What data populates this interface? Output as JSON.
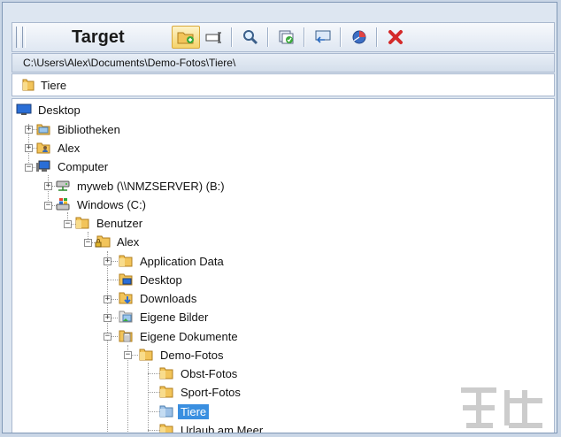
{
  "toolbar": {
    "title": "Target",
    "buttons": [
      {
        "name": "new-folder-icon"
      },
      {
        "name": "rename-icon"
      },
      {
        "name": "search-icon"
      },
      {
        "name": "copy-check-icon"
      },
      {
        "name": "monitor-arrow-icon"
      },
      {
        "name": "refresh-icon"
      },
      {
        "name": "delete-icon"
      }
    ]
  },
  "path": "C:\\Users\\Alex\\Documents\\Demo-Fotos\\Tiere\\",
  "current_folder": "Tiere",
  "tree": {
    "desktop": "Desktop",
    "bibliotheken": "Bibliotheken",
    "alex_root": "Alex",
    "computer": "Computer",
    "myweb": "myweb (\\\\NMZSERVER) (B:)",
    "windows": "Windows (C:)",
    "benutzer": "Benutzer",
    "alex": "Alex",
    "application_data": "Application Data",
    "desktop2": "Desktop",
    "downloads": "Downloads",
    "eigene_bilder": "Eigene Bilder",
    "eigene_dokumente": "Eigene Dokumente",
    "demo_fotos": "Demo-Fotos",
    "obst_fotos": "Obst-Fotos",
    "sport_fotos": "Sport-Fotos",
    "tiere": "Tiere",
    "urlaub": "Urlaub am Meer"
  },
  "colors": {
    "selection": "#3a8fe0",
    "folder": "#e8b23a"
  }
}
